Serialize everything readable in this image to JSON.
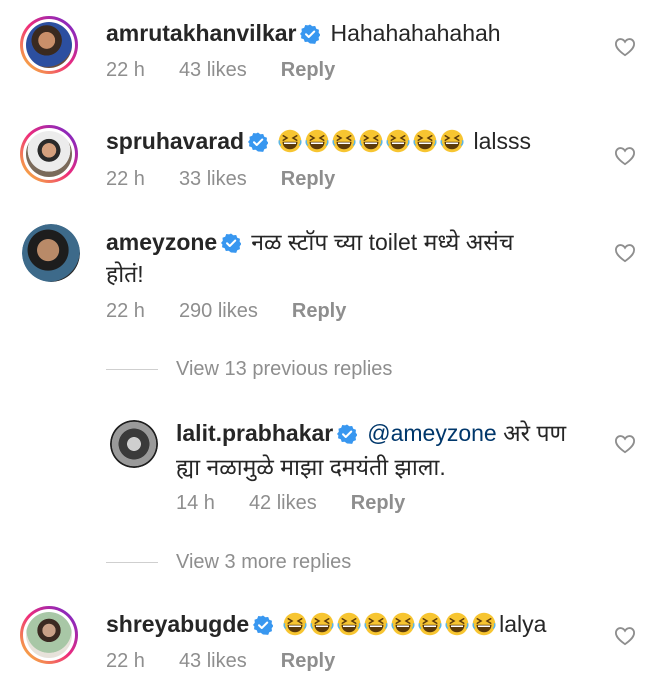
{
  "comments": [
    {
      "username": "amrutakhanvilkar",
      "text": "Hahahahahahah",
      "time": "22 h",
      "likes": "43 likes",
      "reply": "Reply"
    },
    {
      "username": "spruhavarad",
      "emoji": "grinning-squinting-face",
      "text": "lalsss",
      "time": "22 h",
      "likes": "33 likes",
      "reply": "Reply"
    },
    {
      "username": "ameyzone",
      "text_line1": "नळ स्टॉप च्या toilet मध्ये असंच",
      "text_line2": "होतं!",
      "time": "22 h",
      "likes": "290 likes",
      "reply": "Reply"
    },
    {
      "username": "lalit.prabhakar",
      "mention": "@ameyzone",
      "text_line1": "अरे पण",
      "text_line2": "ह्या नळामुळे माझा दमयंती झाला.",
      "time": "14 h",
      "likes": "42 likes",
      "reply": "Reply"
    },
    {
      "username": "shreyabugde",
      "emoji": "grinning-squinting-face",
      "text": "lalya",
      "time": "22 h",
      "likes": "43 likes",
      "reply": "Reply"
    }
  ],
  "view_previous": "View 13 previous replies",
  "view_more": "View 3 more replies",
  "colors": {
    "username": "#262626",
    "meta": "#8e8e8e",
    "mention": "#00376b",
    "verified": "#3897f0"
  },
  "icons": [
    "verified-badge-icon",
    "heart-outline-icon",
    "grinning-squinting-emoji"
  ]
}
